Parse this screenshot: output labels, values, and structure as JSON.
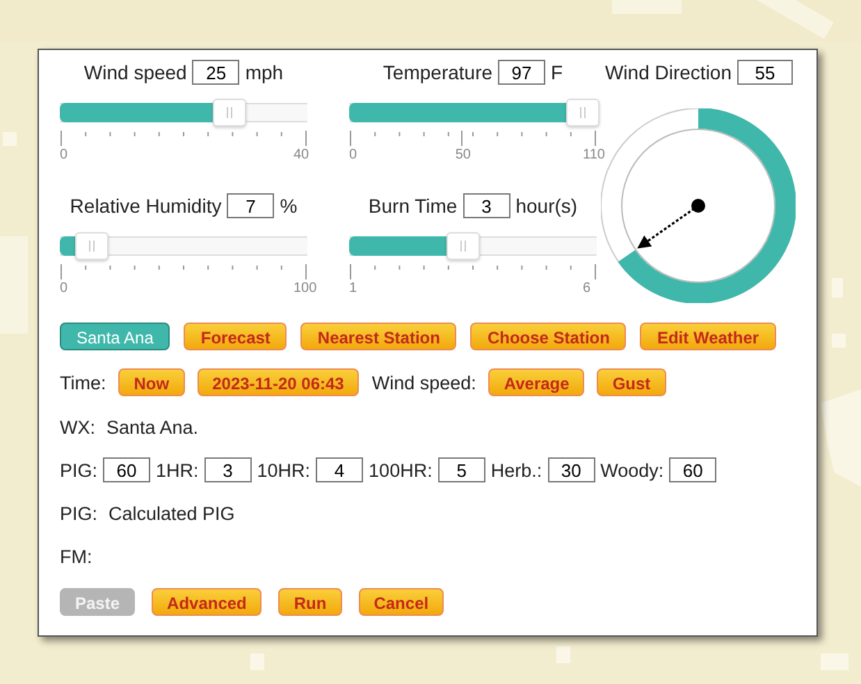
{
  "sliders": [
    {
      "label": "Wind speed",
      "value": "25",
      "unit": "mph",
      "level": 0.625,
      "ticks": [
        "0",
        "40"
      ]
    },
    {
      "label": "Temperature",
      "value": "97",
      "unit": "F",
      "level": 0.88,
      "ticks": [
        "0",
        "50",
        "110"
      ]
    },
    {
      "label": "Relative Humidity",
      "value": "7",
      "unit": "%",
      "level": 0.07,
      "ticks": [
        "0",
        "100"
      ]
    },
    {
      "label": "Burn Time",
      "value": "3",
      "unit": "hour(s)",
      "level": 0.4,
      "ticks": [
        "1",
        "6"
      ]
    }
  ],
  "wind_direction": {
    "label": "Wind Direction",
    "value": "55"
  },
  "modes": [
    {
      "label": "Santa Ana",
      "selected": true
    },
    {
      "label": "Forecast",
      "selected": false
    },
    {
      "label": "Nearest Station",
      "selected": false
    },
    {
      "label": "Choose Station",
      "selected": false
    },
    {
      "label": "Edit Weather",
      "selected": false
    }
  ],
  "time_row": {
    "label": "Time:",
    "buttons": [
      "Now",
      "2023-11-20 06:43"
    ],
    "wind_label": "Wind speed:",
    "wind_buttons": [
      "Average",
      "Gust"
    ]
  },
  "wx": {
    "label": "WX:",
    "value": "Santa Ana."
  },
  "fuels": [
    {
      "label": "PIG:",
      "value": "60"
    },
    {
      "label": "1HR:",
      "value": "3"
    },
    {
      "label": "10HR:",
      "value": "4"
    },
    {
      "label": "100HR:",
      "value": "5"
    },
    {
      "label": "Herb.:",
      "value": "30"
    },
    {
      "label": "Woody:",
      "value": "60"
    }
  ],
  "pig": {
    "label": "PIG:",
    "value": "Calculated PIG"
  },
  "fm": {
    "label": "FM:"
  },
  "actions": [
    {
      "label": "Paste",
      "disabled": true
    },
    {
      "label": "Advanced",
      "disabled": false
    },
    {
      "label": "Run",
      "disabled": false
    },
    {
      "label": "Cancel",
      "disabled": false
    }
  ]
}
